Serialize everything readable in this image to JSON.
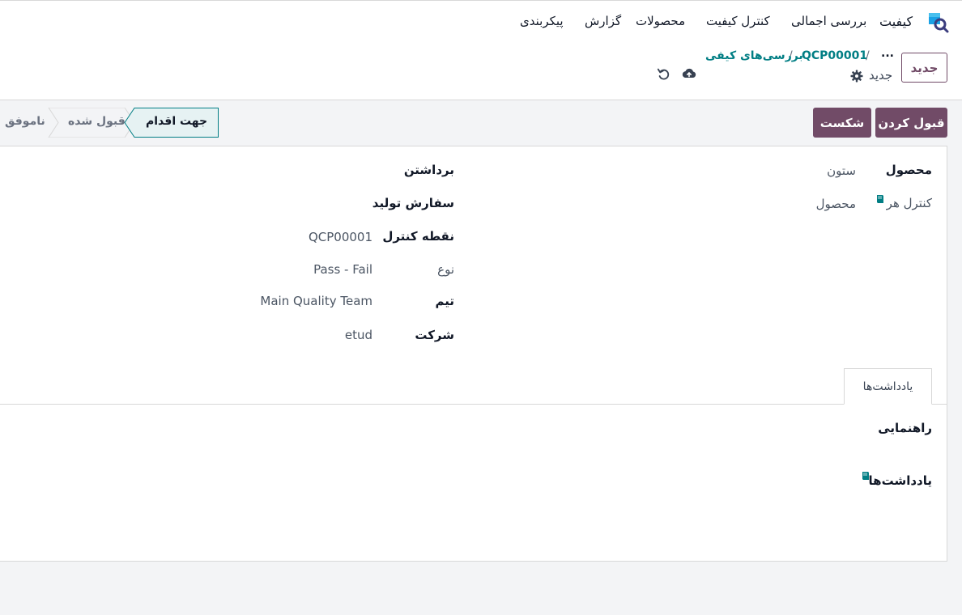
{
  "topbar": {
    "app_name": "کیفیت",
    "nav": [
      "بررسی اجمالی",
      "کنترل کیفیت",
      "محصولات",
      "گزارش",
      "پیکربندی"
    ]
  },
  "control": {
    "new_button": "جدید",
    "breadcrumb": {
      "dots": "...",
      "sep": "/",
      "check": "QCP00001",
      "sep2": "/",
      "parent": "بررسی‌های کیفی"
    },
    "record_label": "جدید",
    "icons": [
      "gear-icon",
      "cloud-upload-icon",
      "undo-icon"
    ]
  },
  "actions": {
    "accept": "قبول کردن",
    "fail": "شکست"
  },
  "statusbar": {
    "stages": [
      "جهت اقدام",
      "قبول شده",
      "ناموفق"
    ],
    "active": "جهت اقدام"
  },
  "form": {
    "right": {
      "product_label": "محصول",
      "product_value": "ستون",
      "control_per_label": "کنترل هر",
      "control_per_value": "محصول"
    },
    "left": {
      "picking_label": "برداشتن",
      "production_label": "سفارش تولید",
      "control_point_label": "نقطه کنترل",
      "control_point_value": "QCP00001",
      "type_label": "نوع",
      "type_value": "Pass - Fail",
      "team_label": "تیم",
      "team_value": "Main Quality Team",
      "company_label": "شرکت",
      "company_value": "etud"
    }
  },
  "notes": {
    "tab": "یادداشت‌ها",
    "instructions_label": "راهنمایی",
    "notes_label": "یادداشت‌ها"
  },
  "colors": {
    "primary": "#714b67",
    "link": "#017e84",
    "status_active": "#e6f2f3"
  }
}
